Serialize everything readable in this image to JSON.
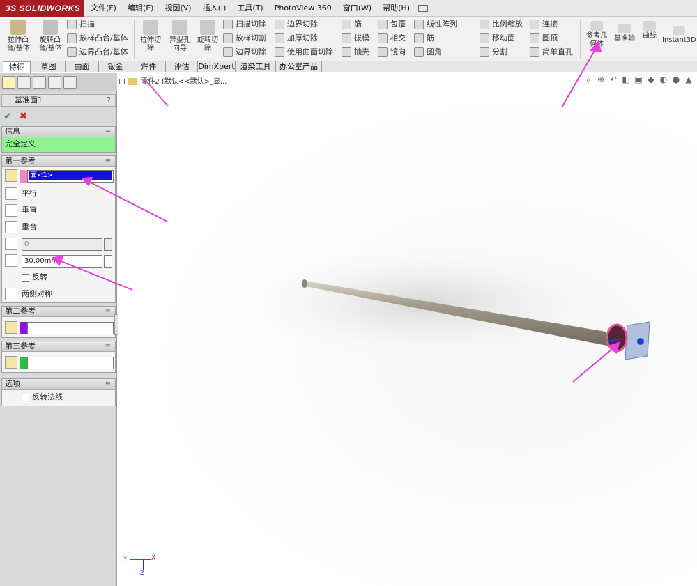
{
  "app": {
    "logo": "3S SOLIDWORKS"
  },
  "menu": [
    "文件(F)",
    "编辑(E)",
    "视图(V)",
    "插入(I)",
    "工具(T)",
    "PhotoView 360",
    "窗口(W)",
    "帮助(H)"
  ],
  "toolbar": {
    "big": [
      {
        "label": "拉伸凸\n台/基体",
        "name": "extruded-boss-button"
      },
      {
        "label": "旋转凸\n台/基体",
        "name": "revolved-boss-button"
      },
      {
        "label": "拉伸切\n除",
        "name": "extruded-cut-button"
      },
      {
        "label": "异型孔\n向导",
        "name": "hole-wizard-button"
      },
      {
        "label": "旋转切\n除",
        "name": "revolved-cut-button"
      }
    ],
    "col1": [
      "扫描",
      "放样凸台/基体",
      "边界凸台/基体"
    ],
    "col2": [
      "扫描切除",
      "放样切割",
      "边界切除"
    ],
    "col3": [
      "边界切除",
      "加厚切除",
      "使用曲面切除"
    ],
    "col4": [
      "筋",
      "拔模",
      "抽壳"
    ],
    "col5": [
      "包覆",
      "相交",
      "镜向"
    ],
    "col6": [
      "线性阵列",
      "筋",
      "圆角"
    ],
    "col7": [
      "比例缩放",
      "移动面",
      "分割"
    ],
    "col8": [
      "连接",
      "圆顶",
      "简单直孔"
    ],
    "right": [
      {
        "label": "参考几\n何体",
        "name": "reference-geometry-button"
      },
      {
        "label": "基准轴",
        "name": "datum-axis-button"
      },
      {
        "label": "曲线",
        "name": "curves-button"
      },
      {
        "label": "Instant3D",
        "name": "instant3d-button"
      }
    ]
  },
  "tabs": [
    "特征",
    "草图",
    "曲面",
    "钣金",
    "焊件",
    "评估",
    "DimXpert",
    "渲染工具",
    "办公室产品"
  ],
  "panel": {
    "title": "基准面1",
    "help": "?",
    "info_header": "信息",
    "info_text": "完全定义",
    "ref1_header": "第一参考",
    "ref1_value": "面<1>",
    "opt_parallel": "平行",
    "opt_perp": "垂直",
    "opt_coincident": "重合",
    "angle_value": "0",
    "distance_value": "30.00mm",
    "flip_label": "反转",
    "mid_plane": "两侧对称",
    "ref2_header": "第二参考",
    "ref3_header": "第三参考",
    "options_header": "选项",
    "flip_normal": "反转法线",
    "colors": {
      "ref1": "#ef88c8",
      "ref2": "#8a14e0",
      "ref3": "#22c43a",
      "info_bg": "#8ef58e"
    }
  },
  "tree": {
    "text": "零件2 (默认<<默认>_显..."
  },
  "axes": {
    "x": "X",
    "y": "Y",
    "z": "Z"
  }
}
